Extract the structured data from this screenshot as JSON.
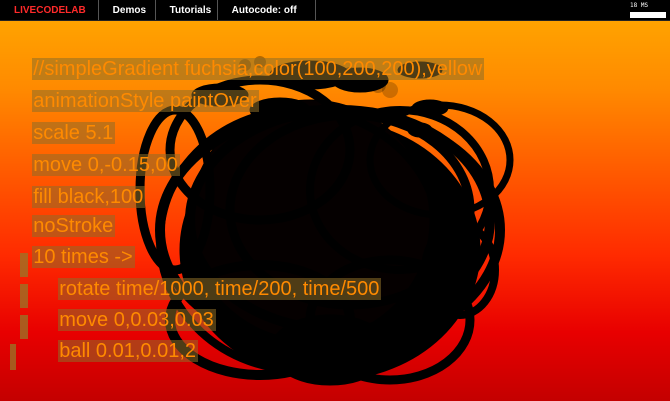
{
  "menubar": {
    "logo": "LIVECODELAB",
    "demos": "Demos",
    "tutorials": "Tutorials",
    "autocode": "Autocode: off",
    "stats": "18 MS"
  },
  "colors": {
    "accent": "#ff2a2a",
    "code_text": "#ff8a00",
    "gradient_top": "#ffa300",
    "gradient_bottom": "#c40000",
    "sculpture": "#000000"
  },
  "code_lines": [
    "//simpleGradient fuchsia,color(100,200,200),yellow",
    "animationStyle paintOver",
    "scale 5.1",
    "move 0,-0.15,00",
    "fill black,100",
    "noStroke",
    "10 times ->",
    "rotate time/1000, time/200, time/500",
    "move 0,0.03,0.03",
    "ball 0.01,0.01,2"
  ]
}
